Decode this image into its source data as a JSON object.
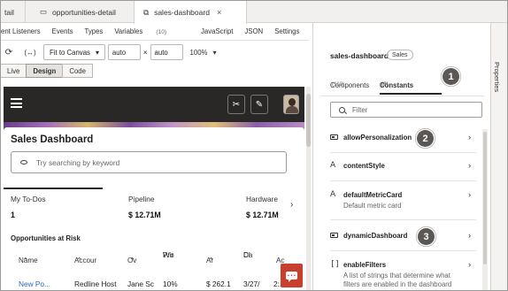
{
  "editor_tabs": [
    {
      "label": "tail"
    },
    {
      "label": "opportunities-detail"
    },
    {
      "label": "sales-dashboard",
      "close": "×"
    }
  ],
  "subtabs": [
    "ent Listeners",
    "Events",
    "Types",
    "Variables",
    "JavaScript",
    "JSON",
    "Settings"
  ],
  "variables_count": "(10)",
  "toolbar": {
    "fit_label": "Fit to Canvas",
    "width_value": "auto",
    "times": "×",
    "height_value": "auto",
    "zoom": "100%"
  },
  "modes": [
    "Live",
    "Design",
    "Code"
  ],
  "canvas": {
    "title": "Sales Dashboard",
    "search_placeholder": "Try searching by keyword",
    "metrics": [
      {
        "label": "My To-Dos",
        "value": "1"
      },
      {
        "label": "Pipeline",
        "value": "$ 12.71M"
      },
      {
        "label": "Hardware",
        "value": "$ 12.71M"
      }
    ],
    "risk_title": "Opportunities at Risk",
    "headers": [
      "Name",
      "Accour",
      "Ov",
      "Wir",
      "Pro",
      "Ar",
      "Cl",
      "Da",
      "Ac"
    ],
    "row": [
      "New Po...",
      "Redline Host",
      "Jane Sc",
      "10%",
      "$ 262.1",
      "3/27/",
      "2:..."
    ]
  },
  "panel": {
    "title": "sales-dashboard",
    "badge": "Sales",
    "tab_components": "Components",
    "components_count": "(113)",
    "tab_constants": "Constants",
    "constants_count": "(8)",
    "filter_placeholder": "Filter",
    "items": [
      {
        "name": "allowPersonalization",
        "icon": "object-icon"
      },
      {
        "name": "contentStyle",
        "icon": "string-icon"
      },
      {
        "name": "defaultMetricCard",
        "icon": "string-icon",
        "desc": "Default metric card"
      },
      {
        "name": "dynamicDashboard",
        "icon": "object-icon"
      },
      {
        "name": "enableFilters",
        "icon": "array-icon",
        "desc": "A list of strings that determine what filters are enabled in the dashboard search bar"
      }
    ]
  },
  "rail_label": "Properties",
  "callouts": [
    "1",
    "2",
    "3"
  ]
}
